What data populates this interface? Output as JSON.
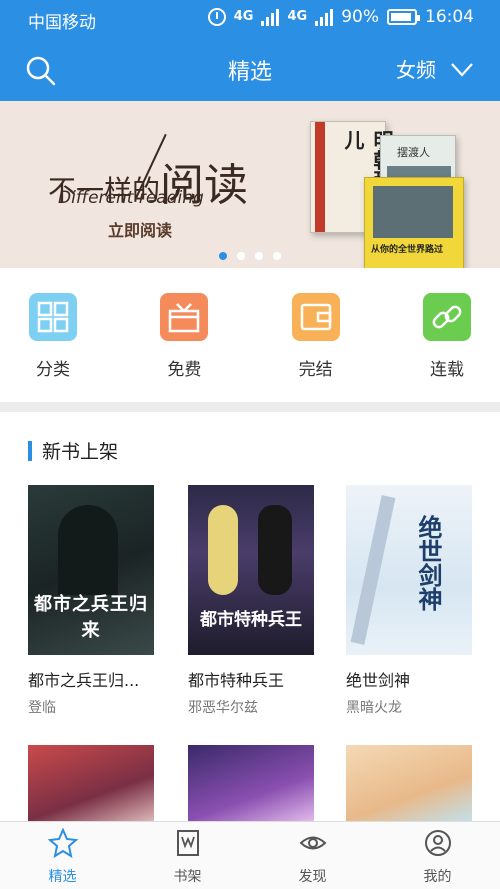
{
  "status": {
    "carrier": "中国移动",
    "network": "4G",
    "network2": "4G",
    "battery": "90%",
    "time": "16:04"
  },
  "header": {
    "title": "精选",
    "gender_filter": "女频"
  },
  "banner": {
    "line1_prefix": "不一样的",
    "line1_big": "阅读",
    "line2": "Different reading",
    "cta": "立即阅读",
    "book_titles": [
      "明朝那些事儿",
      "摆渡人",
      "从你的全世界路过"
    ]
  },
  "categories": [
    {
      "label": "分类",
      "icon": "grid-icon",
      "color": "#7ed0f3"
    },
    {
      "label": "免费",
      "icon": "gift-icon",
      "color": "#f58a5b"
    },
    {
      "label": "完结",
      "icon": "wallet-icon",
      "color": "#f9b157"
    },
    {
      "label": "连载",
      "icon": "link-icon",
      "color": "#6bcd4f"
    }
  ],
  "section": {
    "title": "新书上架"
  },
  "books": [
    {
      "title": "都市之兵王归...",
      "author": "登临",
      "cover_text": "都市之兵王归来"
    },
    {
      "title": "都市特种兵王",
      "author": "邪恶华尔兹",
      "cover_text": "都市特种兵王"
    },
    {
      "title": "绝世剑神",
      "author": "黑暗火龙",
      "cover_text": "绝世剑神"
    }
  ],
  "nav": [
    {
      "label": "精选",
      "icon": "star-icon",
      "active": true
    },
    {
      "label": "书架",
      "icon": "bookshelf-icon",
      "active": false
    },
    {
      "label": "发现",
      "icon": "eye-icon",
      "active": false
    },
    {
      "label": "我的",
      "icon": "profile-icon",
      "active": false
    }
  ],
  "colors": {
    "primary": "#2b8fe3",
    "banner_bg": "#f0e6df"
  }
}
